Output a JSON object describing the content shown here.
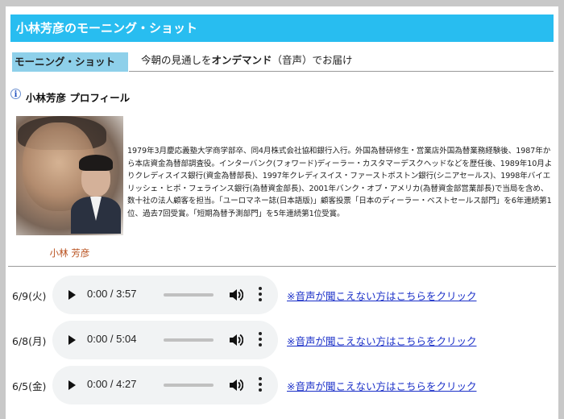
{
  "title": "小林芳彦のモーニング・ショット",
  "section": {
    "label": "モーニング・ショット",
    "desc_prefix": "今朝の見通しを",
    "desc_bold": "オンデマンド",
    "desc_suffix": "（音声）でお届け"
  },
  "profile": {
    "heading": "小林芳彦 プロフィール",
    "info_icon": "i",
    "photo_caption": "小林 芳彦",
    "bio": "1979年3月慶応義塾大学商学部卒、同4月株式会社協和銀行入行。外国為替研修生・営業店外国為替業務経験後、1987年から本店資金為替部調査役。インターバンク(フォワード)ディーラー・カスタマーデスクヘッドなどを歴任後、1989年10月よりクレディスイス銀行(資金為替部長)、1997年クレディスイス・ファーストボストン銀行(シニアセールス)、1998年バイエリッシェ・ヒポ・フェラインス銀行(為替資金部長)、2001年バンク・オブ・アメリカ(為替資金部営業部長)で当局を含め、数十社の法人顧客を担当。「ユーロマネー誌(日本語版)」顧客投票「日本のディーラー・ベストセールス部門」を6年連続第1位、過去7回受賞。「短期為替予測部門」を5年連続第1位受賞。"
  },
  "audio_items": [
    {
      "date": "6/9(火)",
      "time": "0:00 / 3:57",
      "link": "※音声が聞こえない方はこちらをクリック"
    },
    {
      "date": "6/8(月)",
      "time": "0:00 / 5:04",
      "link": "※音声が聞こえない方はこちらをクリック"
    },
    {
      "date": "6/5(金)",
      "time": "0:00 / 4:27",
      "link": "※音声が聞こえない方はこちらをクリック"
    }
  ],
  "icons": {
    "play": "play-icon",
    "volume": "volume-icon",
    "menu": "more-options-icon",
    "info": "info-icon"
  },
  "colors": {
    "title_bar": "#28bdf0",
    "section_label": "#8ed0ea",
    "caption": "#b8501d",
    "link": "#1a2fc8"
  }
}
